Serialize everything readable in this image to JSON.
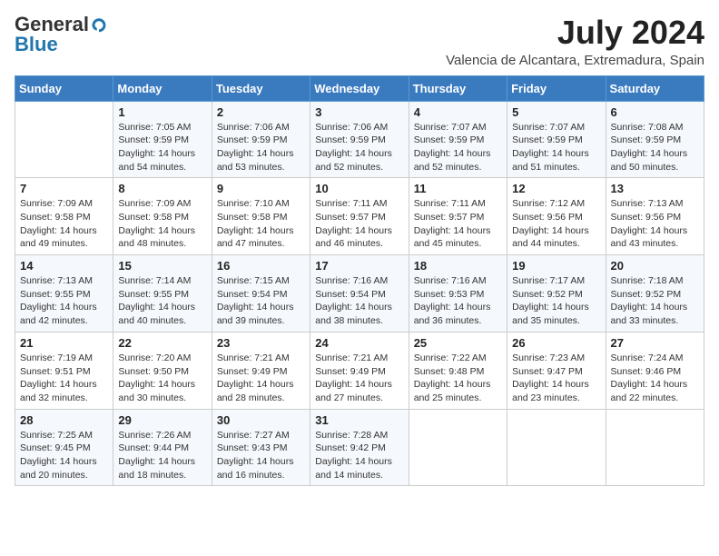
{
  "logo": {
    "general": "General",
    "blue": "Blue"
  },
  "title": "July 2024",
  "location": "Valencia de Alcantara, Extremadura, Spain",
  "days_of_week": [
    "Sunday",
    "Monday",
    "Tuesday",
    "Wednesday",
    "Thursday",
    "Friday",
    "Saturday"
  ],
  "weeks": [
    [
      {
        "num": "",
        "info": ""
      },
      {
        "num": "1",
        "info": "Sunrise: 7:05 AM\nSunset: 9:59 PM\nDaylight: 14 hours\nand 54 minutes."
      },
      {
        "num": "2",
        "info": "Sunrise: 7:06 AM\nSunset: 9:59 PM\nDaylight: 14 hours\nand 53 minutes."
      },
      {
        "num": "3",
        "info": "Sunrise: 7:06 AM\nSunset: 9:59 PM\nDaylight: 14 hours\nand 52 minutes."
      },
      {
        "num": "4",
        "info": "Sunrise: 7:07 AM\nSunset: 9:59 PM\nDaylight: 14 hours\nand 52 minutes."
      },
      {
        "num": "5",
        "info": "Sunrise: 7:07 AM\nSunset: 9:59 PM\nDaylight: 14 hours\nand 51 minutes."
      },
      {
        "num": "6",
        "info": "Sunrise: 7:08 AM\nSunset: 9:59 PM\nDaylight: 14 hours\nand 50 minutes."
      }
    ],
    [
      {
        "num": "7",
        "info": "Sunrise: 7:09 AM\nSunset: 9:58 PM\nDaylight: 14 hours\nand 49 minutes."
      },
      {
        "num": "8",
        "info": "Sunrise: 7:09 AM\nSunset: 9:58 PM\nDaylight: 14 hours\nand 48 minutes."
      },
      {
        "num": "9",
        "info": "Sunrise: 7:10 AM\nSunset: 9:58 PM\nDaylight: 14 hours\nand 47 minutes."
      },
      {
        "num": "10",
        "info": "Sunrise: 7:11 AM\nSunset: 9:57 PM\nDaylight: 14 hours\nand 46 minutes."
      },
      {
        "num": "11",
        "info": "Sunrise: 7:11 AM\nSunset: 9:57 PM\nDaylight: 14 hours\nand 45 minutes."
      },
      {
        "num": "12",
        "info": "Sunrise: 7:12 AM\nSunset: 9:56 PM\nDaylight: 14 hours\nand 44 minutes."
      },
      {
        "num": "13",
        "info": "Sunrise: 7:13 AM\nSunset: 9:56 PM\nDaylight: 14 hours\nand 43 minutes."
      }
    ],
    [
      {
        "num": "14",
        "info": "Sunrise: 7:13 AM\nSunset: 9:55 PM\nDaylight: 14 hours\nand 42 minutes."
      },
      {
        "num": "15",
        "info": "Sunrise: 7:14 AM\nSunset: 9:55 PM\nDaylight: 14 hours\nand 40 minutes."
      },
      {
        "num": "16",
        "info": "Sunrise: 7:15 AM\nSunset: 9:54 PM\nDaylight: 14 hours\nand 39 minutes."
      },
      {
        "num": "17",
        "info": "Sunrise: 7:16 AM\nSunset: 9:54 PM\nDaylight: 14 hours\nand 38 minutes."
      },
      {
        "num": "18",
        "info": "Sunrise: 7:16 AM\nSunset: 9:53 PM\nDaylight: 14 hours\nand 36 minutes."
      },
      {
        "num": "19",
        "info": "Sunrise: 7:17 AM\nSunset: 9:52 PM\nDaylight: 14 hours\nand 35 minutes."
      },
      {
        "num": "20",
        "info": "Sunrise: 7:18 AM\nSunset: 9:52 PM\nDaylight: 14 hours\nand 33 minutes."
      }
    ],
    [
      {
        "num": "21",
        "info": "Sunrise: 7:19 AM\nSunset: 9:51 PM\nDaylight: 14 hours\nand 32 minutes."
      },
      {
        "num": "22",
        "info": "Sunrise: 7:20 AM\nSunset: 9:50 PM\nDaylight: 14 hours\nand 30 minutes."
      },
      {
        "num": "23",
        "info": "Sunrise: 7:21 AM\nSunset: 9:49 PM\nDaylight: 14 hours\nand 28 minutes."
      },
      {
        "num": "24",
        "info": "Sunrise: 7:21 AM\nSunset: 9:49 PM\nDaylight: 14 hours\nand 27 minutes."
      },
      {
        "num": "25",
        "info": "Sunrise: 7:22 AM\nSunset: 9:48 PM\nDaylight: 14 hours\nand 25 minutes."
      },
      {
        "num": "26",
        "info": "Sunrise: 7:23 AM\nSunset: 9:47 PM\nDaylight: 14 hours\nand 23 minutes."
      },
      {
        "num": "27",
        "info": "Sunrise: 7:24 AM\nSunset: 9:46 PM\nDaylight: 14 hours\nand 22 minutes."
      }
    ],
    [
      {
        "num": "28",
        "info": "Sunrise: 7:25 AM\nSunset: 9:45 PM\nDaylight: 14 hours\nand 20 minutes."
      },
      {
        "num": "29",
        "info": "Sunrise: 7:26 AM\nSunset: 9:44 PM\nDaylight: 14 hours\nand 18 minutes."
      },
      {
        "num": "30",
        "info": "Sunrise: 7:27 AM\nSunset: 9:43 PM\nDaylight: 14 hours\nand 16 minutes."
      },
      {
        "num": "31",
        "info": "Sunrise: 7:28 AM\nSunset: 9:42 PM\nDaylight: 14 hours\nand 14 minutes."
      },
      {
        "num": "",
        "info": ""
      },
      {
        "num": "",
        "info": ""
      },
      {
        "num": "",
        "info": ""
      }
    ]
  ]
}
